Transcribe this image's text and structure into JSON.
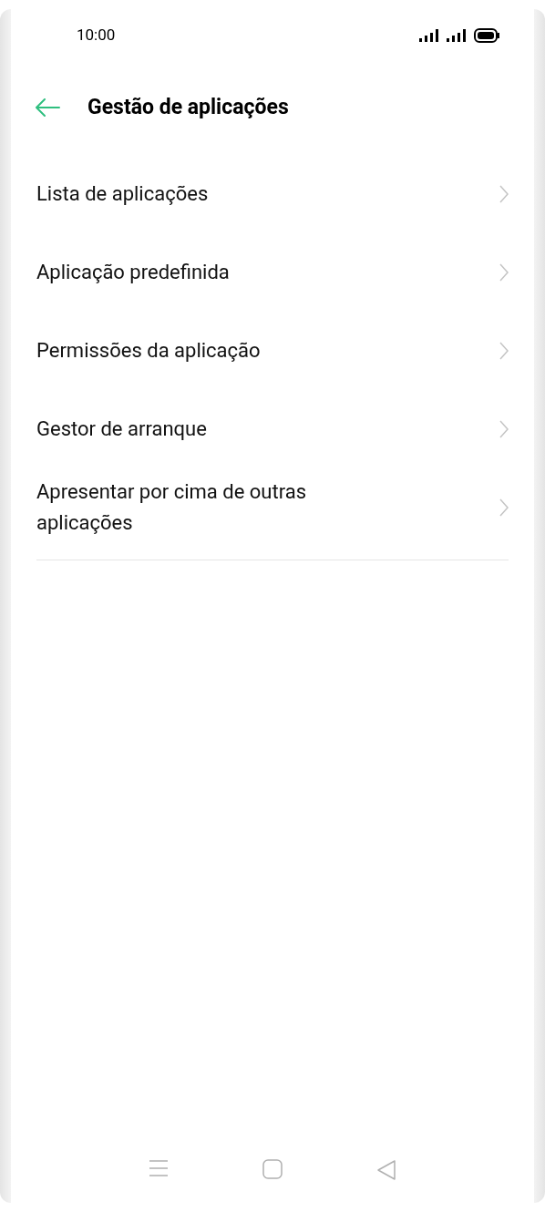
{
  "status_bar": {
    "time": "10:00"
  },
  "header": {
    "title": "Gestão de aplicações"
  },
  "items": [
    {
      "label": "Lista de aplicações"
    },
    {
      "label": "Aplicação predefinida"
    },
    {
      "label": "Permissões da aplicação"
    },
    {
      "label": "Gestor de arranque"
    },
    {
      "label": "Apresentar por cima de outras aplicações"
    }
  ]
}
